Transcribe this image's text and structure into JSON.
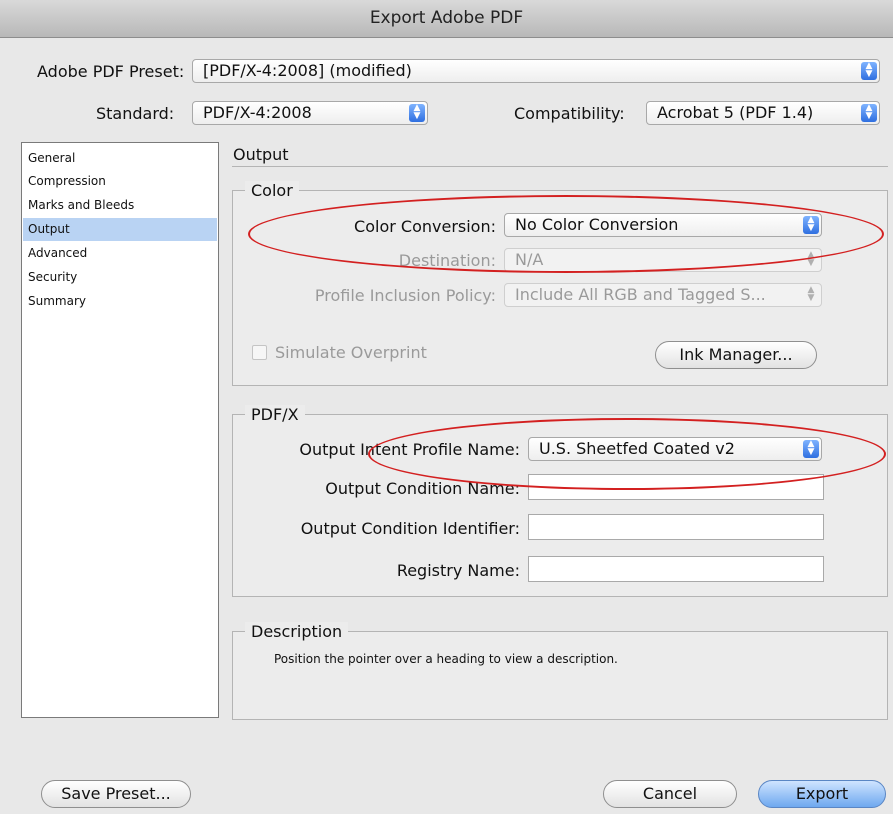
{
  "window": {
    "title": "Export Adobe PDF"
  },
  "preset": {
    "label": "Adobe PDF Preset:",
    "value": "[PDF/X-4:2008] (modified)"
  },
  "standard": {
    "label": "Standard:",
    "value": "PDF/X-4:2008"
  },
  "compatibility": {
    "label": "Compatibility:",
    "value": "Acrobat 5 (PDF 1.4)"
  },
  "sidebar": {
    "items": [
      {
        "label": "General"
      },
      {
        "label": "Compression"
      },
      {
        "label": "Marks and Bleeds"
      },
      {
        "label": "Output"
      },
      {
        "label": "Advanced"
      },
      {
        "label": "Security"
      },
      {
        "label": "Summary"
      }
    ],
    "selected": "Output"
  },
  "section": {
    "title": "Output"
  },
  "color": {
    "legend": "Color",
    "conversion_label": "Color Conversion:",
    "conversion_value": "No Color Conversion",
    "destination_label": "Destination:",
    "destination_value": "N/A",
    "profile_policy_label": "Profile Inclusion Policy:",
    "profile_policy_value": "Include All RGB and Tagged S...",
    "simulate_overprint_label": "Simulate Overprint",
    "simulate_overprint_checked": false,
    "ink_manager_label": "Ink Manager..."
  },
  "pdfx": {
    "legend": "PDF/X",
    "intent_label": "Output Intent Profile Name:",
    "intent_value": "U.S. Sheetfed Coated v2",
    "condition_name_label": "Output Condition Name:",
    "condition_name_value": "",
    "condition_id_label": "Output Condition Identifier:",
    "condition_id_value": "",
    "registry_label": "Registry Name:",
    "registry_value": ""
  },
  "description": {
    "legend": "Description",
    "text": "Position the pointer over a heading to view a description."
  },
  "buttons": {
    "save_preset": "Save Preset...",
    "cancel": "Cancel",
    "export": "Export"
  },
  "annotations": {
    "ellipse_color": "#d32020"
  }
}
